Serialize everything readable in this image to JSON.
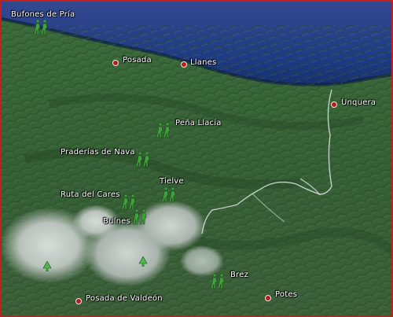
{
  "colors": {
    "sea": "#1d3d8f",
    "terrain": "#3d6a3c",
    "mountain": "#c8cfcf",
    "hiker_icon": "#3ea33a",
    "town_dot": "#b51d1d",
    "frame": "#c21f1f",
    "route": "#d4dcdc"
  },
  "icons": {
    "hiking_marker": "hikers-icon",
    "town_marker": "town-dot-icon",
    "peak_marker": "tree-icon"
  },
  "places": {
    "bufones": "Bufones de Pría",
    "posada": "Posada",
    "llanes": "Llanes",
    "unquera": "Unquera",
    "pena_llacia": "Peña Llacia",
    "praderias": "Praderías de Nava",
    "tielve": "Tielve",
    "ruta_cares": "Ruta del Cares",
    "bulnes": "Bulnes",
    "brez": "Brez",
    "potes": "Potes",
    "posada_valdeon": "Posada de Valdeón"
  }
}
